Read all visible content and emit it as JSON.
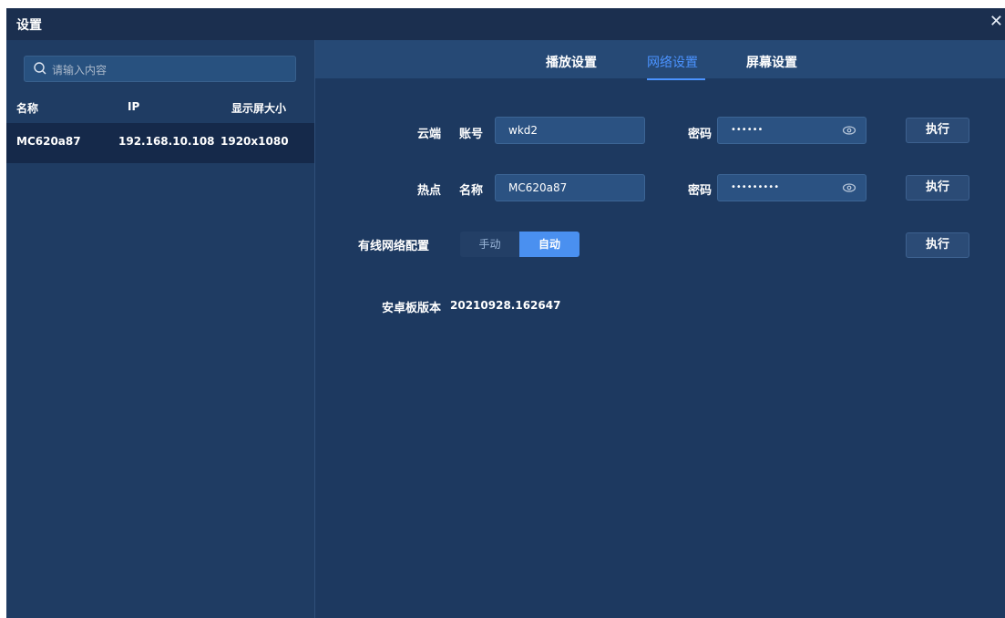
{
  "window": {
    "title": "设置",
    "close": "✕"
  },
  "sidebar": {
    "search_placeholder": "请输入内容",
    "columns": {
      "name": "名称",
      "ip": "IP",
      "screen_size": "显示屏大小"
    },
    "rows": [
      {
        "name": "MC620a87",
        "ip": "192.168.10.108",
        "screen_size": "1920x1080"
      }
    ]
  },
  "tabs": [
    "播放设置",
    "网络设置",
    "屏幕设置"
  ],
  "active_tab": "网络设置",
  "network": {
    "cloud": {
      "label": "云端",
      "account_label": "账号",
      "account_value": "wkd2",
      "password_label": "密码",
      "password_mask": "••••••",
      "execute": "执行"
    },
    "hotspot": {
      "label": "热点",
      "name_label": "名称",
      "name_value": "MC620a87",
      "password_label": "密码",
      "password_mask": "•••••••••",
      "execute": "执行"
    },
    "wired": {
      "label": "有线网络配置",
      "option_manual": "手动",
      "option_auto": "自动",
      "selected": "自动",
      "execute": "执行"
    },
    "android_version": {
      "label": "安卓板版本",
      "value": "20210928.162647"
    }
  },
  "colors": {
    "accent": "#4b93ff",
    "background": "#1d3960",
    "header": "#264975"
  }
}
